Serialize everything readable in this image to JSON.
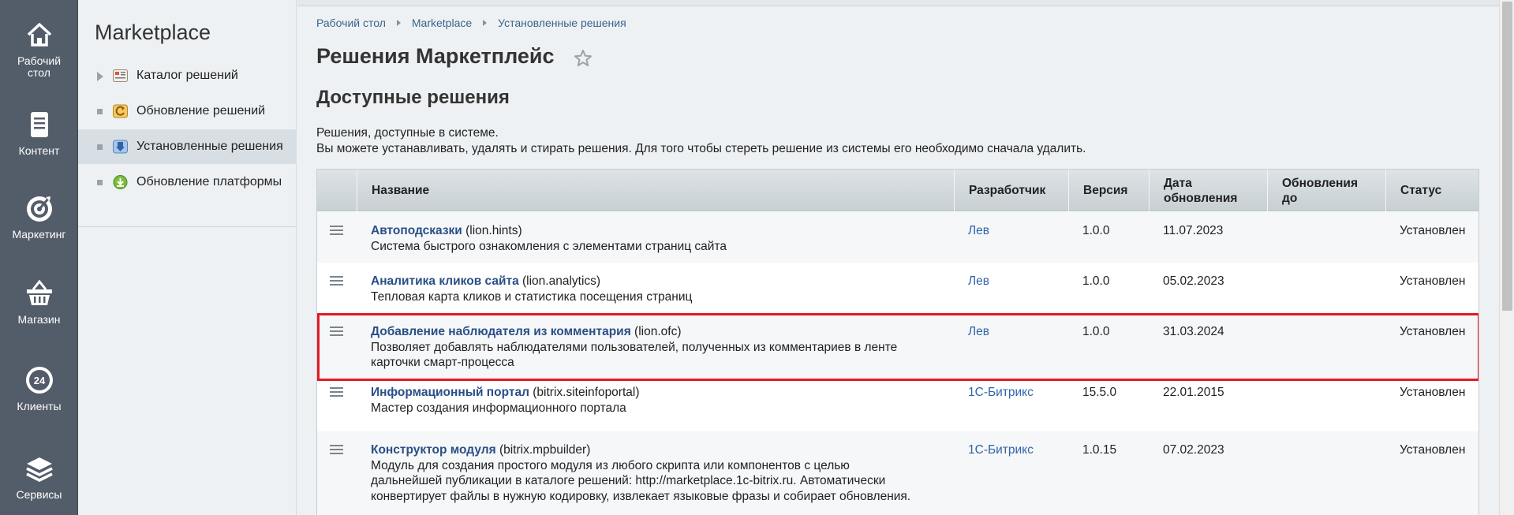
{
  "rail": {
    "items": [
      {
        "label": "Рабочий\nстол",
        "icon": "home-icon"
      },
      {
        "label": "Контент",
        "icon": "document-icon"
      },
      {
        "label": "Маркетинг",
        "icon": "target-icon"
      },
      {
        "label": "Магазин",
        "icon": "basket-icon"
      },
      {
        "label": "Клиенты",
        "icon": "clients-24-icon"
      },
      {
        "label": "Сервисы",
        "icon": "layers-icon"
      }
    ],
    "clients_badge": "24"
  },
  "section_nav": {
    "title": "Marketplace",
    "items": [
      {
        "label": "Каталог решений",
        "icon": "catalog-icon"
      },
      {
        "label": "Обновление решений",
        "icon": "update-solutions-icon"
      },
      {
        "label": "Установленные решения",
        "icon": "installed-solutions-icon"
      },
      {
        "label": "Обновление платформы",
        "icon": "platform-update-icon"
      }
    ]
  },
  "breadcrumb": [
    "Рабочий стол",
    "Marketplace",
    "Установленные решения"
  ],
  "page": {
    "title": "Решения Маркетплейс",
    "subtitle": "Доступные решения",
    "desc_line1": "Решения, доступные в системе.",
    "desc_line2": "Вы можете устанавливать, удалять и стирать решения. Для того чтобы стереть решение из системы его необходимо сначала удалить."
  },
  "table": {
    "headers": {
      "name": "Название",
      "developer": "Разработчик",
      "version": "Версия",
      "updated_line1": "Дата",
      "updated_line2": "обновления",
      "updates_until_line1": "Обновления",
      "updates_until_line2": "до",
      "status": "Статус"
    },
    "rows": [
      {
        "name": "Автоподсказки",
        "code": " (lion.hints)",
        "desc": "Система быстрого ознакомления с элементами страниц сайта",
        "developer": "Лев",
        "version": "1.0.0",
        "date": "11.07.2023",
        "until": "",
        "status": "Установлен"
      },
      {
        "name": "Аналитика кликов сайта",
        "code": " (lion.analytics)",
        "desc": "Тепловая карта кликов и статистика посещения страниц",
        "developer": "Лев",
        "version": "1.0.0",
        "date": "05.02.2023",
        "until": "",
        "status": "Установлен"
      },
      {
        "name": "Добавление наблюдателя из комментария",
        "code": " (lion.ofc)",
        "desc": "Позволяет добавлять наблюдателями пользователей, полученных из комментариев в ленте",
        "desc2": "карточки смарт-процесса",
        "developer": "Лев",
        "version": "1.0.0",
        "date": "31.03.2024",
        "until": "",
        "status": "Установлен"
      },
      {
        "name": "Информационный портал",
        "code": " (bitrix.siteinfoportal)",
        "desc": "Мастер создания информационного портала",
        "developer": "1С-Битрикс",
        "version": "15.5.0",
        "date": "22.01.2015",
        "until": "",
        "status": "Установлен"
      },
      {
        "name": "Конструктор модуля",
        "code": " (bitrix.mpbuilder)",
        "desc": "Модуль для создания простого модуля из любого скрипта или компонентов с целью",
        "desc2": "дальнейшей публикации в каталоге решений: http://marketplace.1c-bitrix.ru. Автоматически",
        "desc3": "конвертирует файлы в нужную кодировку, извлекает языковые фразы и собирает обновления.",
        "developer": "1С-Битрикс",
        "version": "1.0.15",
        "date": "07.02.2023",
        "until": "",
        "status": "Установлен"
      }
    ]
  },
  "colors": {
    "highlight": "#e01b24",
    "link": "#2a4f86",
    "rail_bg": "#535c69"
  }
}
